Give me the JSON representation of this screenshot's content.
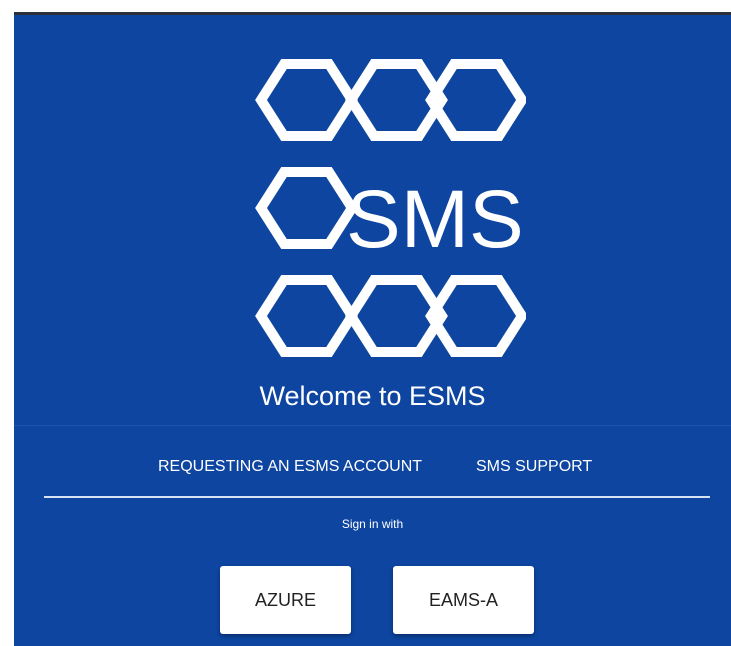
{
  "logo": {
    "text": "SMS"
  },
  "header": {
    "welcome": "Welcome to ESMS"
  },
  "nav": {
    "request_account": "REQUESTING AN ESMS ACCOUNT",
    "support": "SMS SUPPORT"
  },
  "signin": {
    "label": "Sign in with",
    "azure": "AZURE",
    "eams": "EAMS-A"
  },
  "colors": {
    "background": "#0d45a0",
    "button": "#ffffff"
  }
}
